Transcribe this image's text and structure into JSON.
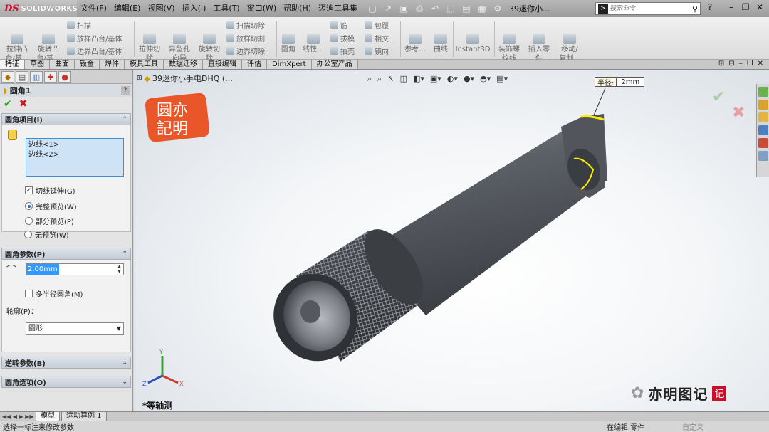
{
  "app": {
    "logo_prefix": "DS",
    "logo_name": "SOLIDWORKS",
    "doc_title": "39迷你小..."
  },
  "menu": [
    "文件(F)",
    "编辑(E)",
    "视图(V)",
    "插入(I)",
    "工具(T)",
    "窗口(W)",
    "帮助(H)",
    "迈迪工具集"
  ],
  "search": {
    "placeholder": "搜索命令"
  },
  "toolbar": {
    "big": [
      {
        "label": "拉伸凸\n台/基...",
        "icon": "extrude-boss-icon"
      },
      {
        "label": "旋转凸\n台/基...",
        "icon": "revolve-boss-icon"
      },
      {
        "label": "拉伸切\n除",
        "icon": "extrude-cut-icon"
      },
      {
        "label": "异型孔\n向导",
        "icon": "hole-wizard-icon"
      },
      {
        "label": "旋转切\n除",
        "icon": "revolve-cut-icon"
      },
      {
        "label": "圆角",
        "icon": "fillet-icon"
      },
      {
        "label": "线性...",
        "icon": "linear-pattern-icon"
      },
      {
        "label": "参考...",
        "icon": "reference-geometry-icon"
      },
      {
        "label": "曲线",
        "icon": "curves-icon"
      },
      {
        "label": "Instant3D",
        "icon": "instant3d-icon"
      },
      {
        "label": "装饰螺\n纹线",
        "icon": "cosmetic-thread-icon"
      },
      {
        "label": "插入零\n件",
        "icon": "insert-part-icon"
      },
      {
        "label": "移动/\n复制...",
        "icon": "move-copy-icon"
      }
    ],
    "small": [
      "扫描",
      "放样凸台/基体",
      "边界凸台/基体",
      "扫描切除",
      "放样切割",
      "边界切除",
      "筋",
      "拔模",
      "抽壳",
      "包覆",
      "相交",
      "镜向"
    ]
  },
  "tabs": [
    "特征",
    "草图",
    "曲面",
    "钣金",
    "焊件",
    "模具工具",
    "数据迁移",
    "直接编辑",
    "评估",
    "DimXpert",
    "办公室产品"
  ],
  "property_manager": {
    "title": "圆角1",
    "help": "?",
    "ok": "✔",
    "cancel": "✖",
    "items_group": {
      "title": "圆角项目(I)",
      "edges": [
        "边线<1>",
        "边线<2>"
      ],
      "tangent_propagation": "切线延伸(G)",
      "full_preview": "完整预览(W)",
      "partial_preview": "部分预览(P)",
      "no_preview": "无预览(W)"
    },
    "params_group": {
      "title": "圆角参数(P)",
      "radius": "2.00mm",
      "multi_radius": "多半径圆角(M)",
      "profile_label": "轮廓(P)：",
      "profile_value": "圆形"
    },
    "setback_group": {
      "title": "逆转参数(B)"
    },
    "options_group": {
      "title": "圆角选项(O)"
    }
  },
  "graphics": {
    "tree_root": "39迷你小手电DHQ  (...",
    "radius_callout_key": "半径:",
    "radius_callout_value": "2mm",
    "view_orientation": "*等轴测",
    "seal_text": [
      "圆亦",
      "記明"
    ],
    "watermark": "亦明图记",
    "watermark_stamp": "记"
  },
  "bottom_tabs": [
    "模型",
    "运动算例 1"
  ],
  "status": {
    "message": "选择一标注来修改参数",
    "state": "在编辑 零件",
    "units": "自定义"
  },
  "colors": {
    "brand_red": "#c8102e",
    "selection_yellow": "#ffee00",
    "part_gray": "#5b5e63",
    "ok_green": "#2fa82f",
    "cancel_red": "#c21e1e"
  }
}
